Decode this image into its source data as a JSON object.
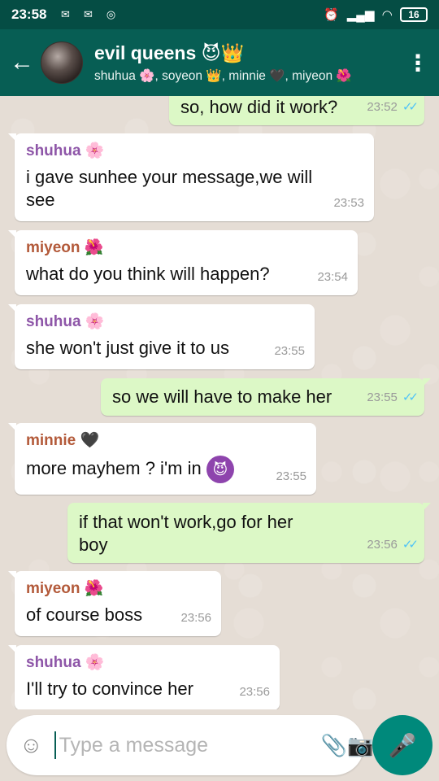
{
  "status_bar": {
    "time": "23:58",
    "battery": "16"
  },
  "header": {
    "title": "evil queens 😈👑",
    "members": "shuhua 🌸, soyeon 👑, minnie 🖤, miyeon 🌺"
  },
  "messages": [
    {
      "dir": "out",
      "text": "so, how did it work?",
      "time": "23:52",
      "ticks": "✓✓"
    },
    {
      "dir": "in",
      "sender": "shuhua 🌸",
      "sender_color": "#8e56a8",
      "text": "i gave sunhee your message,we will see",
      "time": "23:53"
    },
    {
      "dir": "in",
      "sender": "miyeon 🌺",
      "sender_color": "#b35a3a",
      "text": "what do you think will happen?",
      "time": "23:54"
    },
    {
      "dir": "in",
      "sender": "shuhua 🌸",
      "sender_color": "#8e56a8",
      "text": "she won't just give it to us",
      "time": "23:55"
    },
    {
      "dir": "out",
      "text": "so we will have to make her",
      "time": "23:55",
      "ticks": "✓✓"
    },
    {
      "dir": "in",
      "sender": "minnie 🖤",
      "sender_color": "#b35a3a",
      "text": "more mayhem ? i'm in",
      "emoji": "😈",
      "time": "23:55"
    },
    {
      "dir": "out",
      "text": "if that won't work,go for her boy",
      "time": "23:56",
      "ticks": "✓✓"
    },
    {
      "dir": "in",
      "sender": "miyeon 🌺",
      "sender_color": "#b35a3a",
      "text": "of course boss",
      "time": "23:56"
    },
    {
      "dir": "in",
      "sender": "shuhua 🌸",
      "sender_color": "#8e56a8",
      "text": "I'll try to convince her",
      "time": "23:56"
    }
  ],
  "input": {
    "placeholder": "Type a message"
  },
  "colors": {
    "header": "#075e54",
    "status_bar": "#054d44",
    "outgoing_bubble": "#dcf8c6",
    "incoming_bubble": "#ffffff",
    "mic_button": "#00897b",
    "read_ticks": "#4fc3f7"
  }
}
